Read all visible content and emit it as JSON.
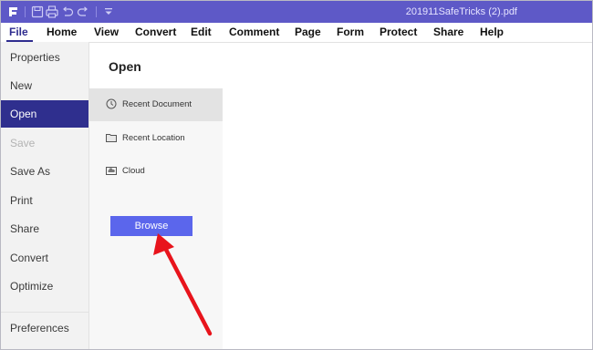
{
  "app": {
    "document_title": "201911SafeTricks (2).pdf",
    "accent_color": "#5e59c7",
    "toolbar_icons": [
      "app-logo-icon",
      "save-icon",
      "print-icon",
      "undo-icon",
      "redo-icon",
      "customize-toolbar-icon"
    ]
  },
  "menu": {
    "items": [
      "File",
      "Home",
      "View",
      "Convert",
      "Edit",
      "Comment",
      "Page",
      "Form",
      "Protect",
      "Share",
      "Help"
    ],
    "active": "File"
  },
  "file_nav": {
    "items": [
      {
        "label": "Properties",
        "state": "normal"
      },
      {
        "label": "New",
        "state": "normal"
      },
      {
        "label": "Open",
        "state": "active"
      },
      {
        "label": "Save",
        "state": "disabled"
      },
      {
        "label": "Save As",
        "state": "normal"
      },
      {
        "label": "Print",
        "state": "normal"
      },
      {
        "label": "Share",
        "state": "normal"
      },
      {
        "label": "Convert",
        "state": "normal"
      },
      {
        "label": "Optimize",
        "state": "normal"
      },
      {
        "label": "Preferences",
        "state": "normal"
      }
    ],
    "active_color": "#2f2f8e"
  },
  "open_panel": {
    "title": "Open",
    "locations": [
      {
        "label": "Recent Document",
        "icon": "clock-icon",
        "selected": true
      },
      {
        "label": "Recent Location",
        "icon": "folder-icon",
        "selected": false
      },
      {
        "label": "Cloud",
        "icon": "cloud-icon",
        "selected": false
      }
    ],
    "browse_label": "Browse",
    "browse_color": "#5b66ec"
  },
  "annotation": {
    "arrow_color": "#e8141c",
    "points_to": "browse-button"
  }
}
